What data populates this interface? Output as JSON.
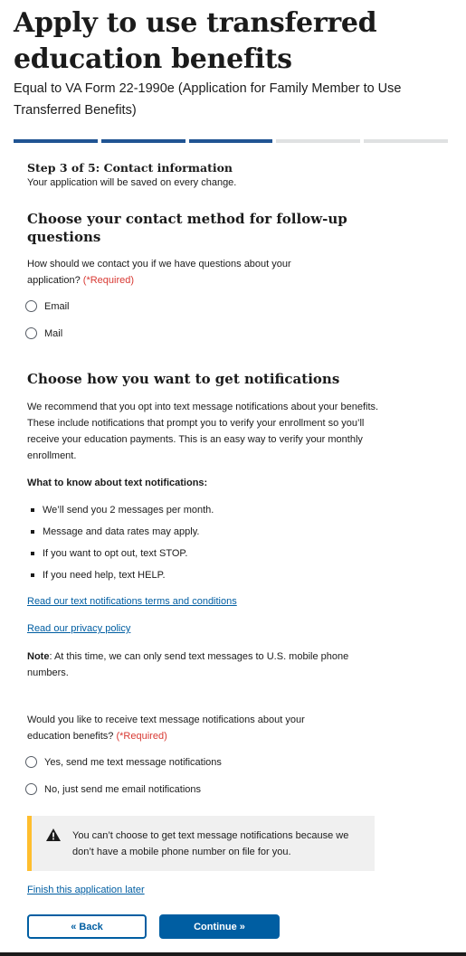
{
  "header": {
    "title": "Apply to use transferred education benefits",
    "subtitle": "Equal to VA Form 22-1990e (Application for Family Member to Use Transferred Benefits)"
  },
  "progress": {
    "total_steps": 5,
    "current_step": 3
  },
  "step": {
    "title": "Step 3 of 5: Contact information",
    "subtitle": "Your application will be saved on every change."
  },
  "contact_section": {
    "heading": "Choose your contact method for follow-up questions",
    "question": "How should we contact you if we have questions about your application?",
    "required": "(*Required)",
    "options": [
      "Email",
      "Mail"
    ]
  },
  "notifications_section": {
    "heading": "Choose how you want to get notifications",
    "intro": "We recommend that you opt into text message notifications about your benefits. These include notifications that prompt you to verify your enrollment so you’ll receive your education payments. This is an easy way to verify your monthly enrollment.",
    "know_heading": "What to know about text notifications:",
    "bullets": [
      "We’ll send you 2 messages per month.",
      "Message and data rates may apply.",
      "If you want to opt out, text STOP.",
      "If you need help, text HELP."
    ],
    "terms_link": "Read our text notifications terms and conditions",
    "privacy_link": "Read our privacy policy",
    "note_label": "Note",
    "note_text": ": At this time, we can only send text messages to U.S. mobile phone numbers.",
    "question": "Would you like to receive text message notifications about your education benefits?",
    "required": "(*Required)",
    "options": [
      "Yes, send me text message notifications",
      "No, just send me email notifications"
    ]
  },
  "alert": {
    "icon": "warning-icon",
    "accent_color": "#ffbe2e",
    "text": "You can’t choose to get text message notifications because we don’t have a mobile phone number on file for you."
  },
  "footer": {
    "finish_later_link": "Finish this application later",
    "back_label": "« Back",
    "continue_label": "Continue »"
  },
  "colors": {
    "primary": "#005ea2",
    "progress_done": "#205493",
    "required": "#d83933"
  }
}
